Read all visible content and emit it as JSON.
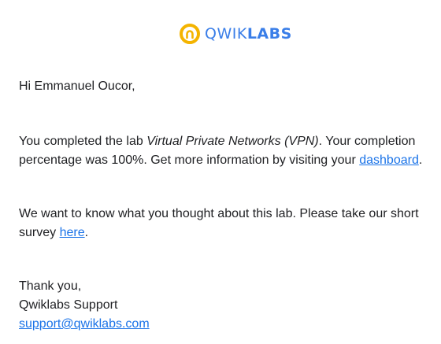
{
  "brand": {
    "logo_light": "QWIK",
    "logo_bold": "LABS",
    "icon": "qwiklabs-logo-icon",
    "colors": {
      "ring": "#f4b400",
      "text": "#3a7ee8",
      "link": "#1a73e8"
    }
  },
  "email": {
    "greeting": "Hi Emmanuel Oucor,",
    "para1": {
      "prefix": "You completed the lab ",
      "lab_name": "Virtual Private Networks (VPN)",
      "middle": ". Your completion percentage was 100%. Get more information by visiting your ",
      "link_text": "dashboard",
      "suffix": "."
    },
    "para2": {
      "prefix": "We want to know what you thought about this lab. Please take our short survey ",
      "link_text": "here",
      "suffix": "."
    },
    "signoff": {
      "line1": "Thank you,",
      "line2": "Qwiklabs Support",
      "email_link": "support@qwiklabs.com"
    }
  }
}
